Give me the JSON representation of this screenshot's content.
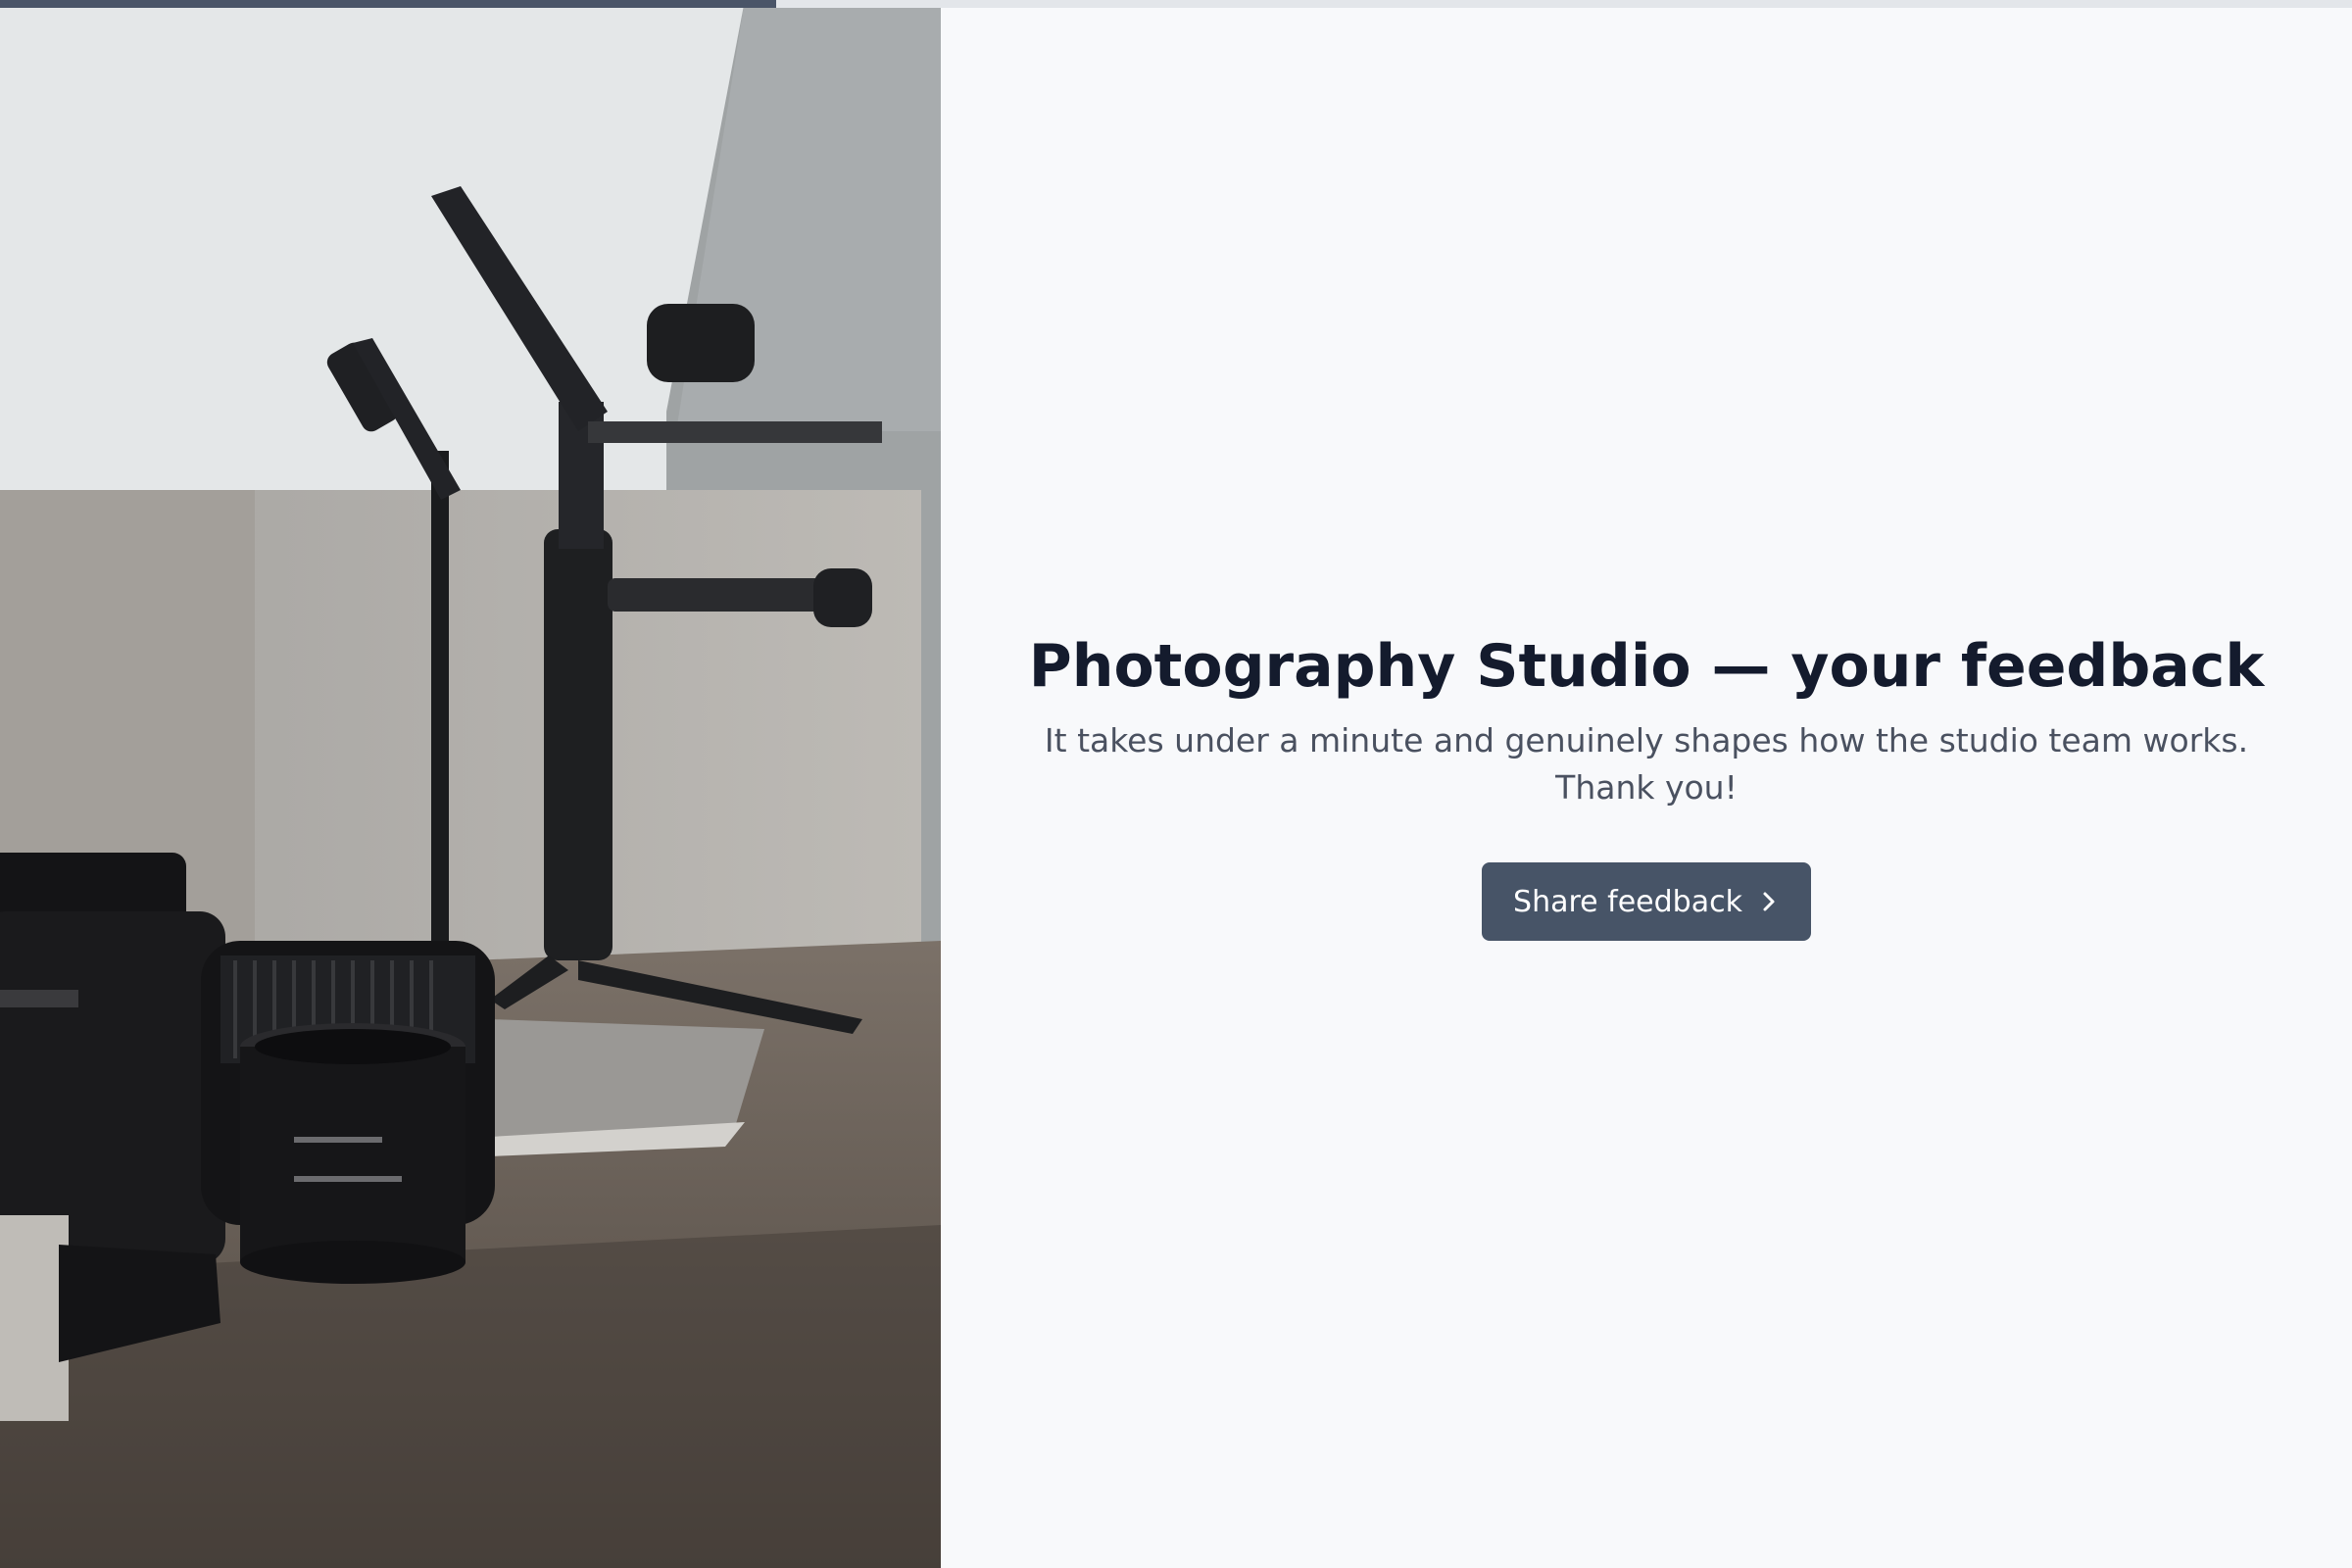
{
  "progress": {
    "fraction": 0.33,
    "track_color": "#e3e6ea",
    "fill_color": "#4a5568"
  },
  "hero_image": {
    "icon": "studio-camera-photo"
  },
  "survey": {
    "title": "Photography Studio — your feedback",
    "subtitle": "It takes under a minute and genuinely shapes how the studio team works. Thank you!",
    "cta_label": "Share feedback",
    "cta_icon": "chevron-right-icon",
    "accent_color": "#475467"
  }
}
